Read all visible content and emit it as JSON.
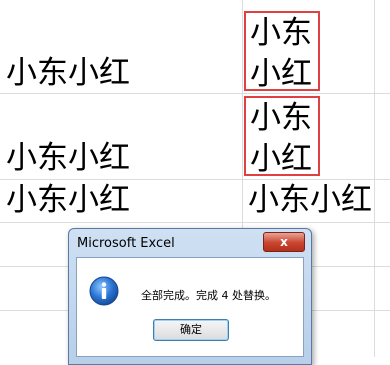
{
  "sheet": {
    "cells": {
      "a1": "小东小红",
      "a2": "小东小红",
      "a3": "小东小红",
      "b3": "小东小红"
    },
    "wrapped_cells": [
      {
        "line1": "小东",
        "line2": "小红"
      },
      {
        "line1": "小东",
        "line2": "小红"
      }
    ]
  },
  "dialog": {
    "title": "Microsoft Excel",
    "close_label": "x",
    "message": "全部完成。完成 4 处替换。",
    "ok_label": "确定",
    "icon": "info-icon"
  },
  "colors": {
    "highlight_border": "#e04040",
    "grid_line": "#dadcdd",
    "close_button": "#c8452f"
  }
}
